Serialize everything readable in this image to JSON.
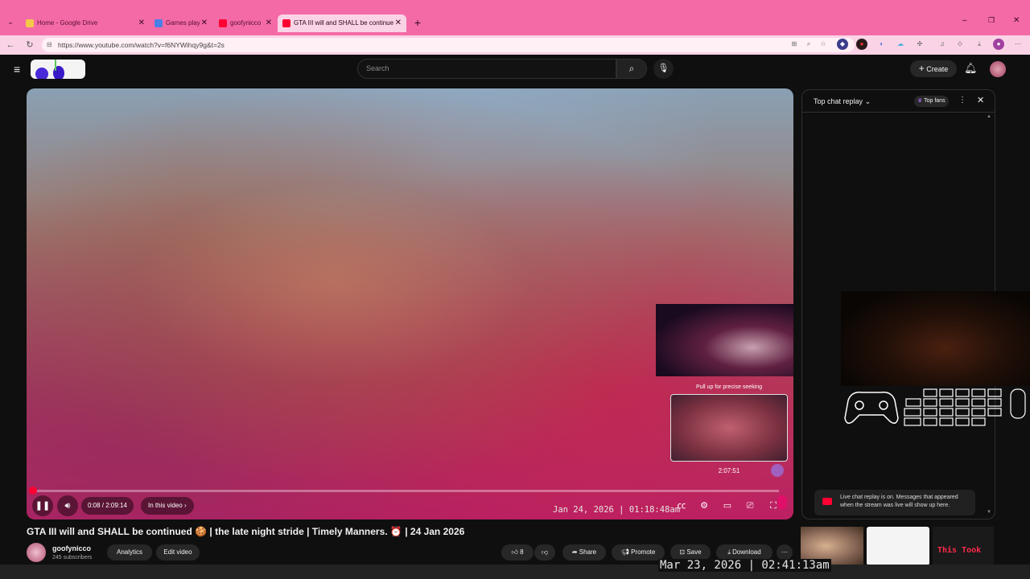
{
  "browser": {
    "tabs": [
      {
        "label": "Home - Google Drive",
        "active": false
      },
      {
        "label": "Games play",
        "active": false
      },
      {
        "label": "goofynicco",
        "active": false
      },
      {
        "label": "GTA III will and SHALL be continue",
        "active": true
      }
    ],
    "url": "https://www.youtube.com/watch?v=f6NYWihqy9g&t=2s"
  },
  "header": {
    "search_placeholder": "Search",
    "create_label": "Create"
  },
  "player": {
    "pull_up_hint": "Pull up for precise seeking",
    "preview_time": "2:07:51",
    "time_display": "0:08 / 2:09:14",
    "chapter_label": "In this video",
    "video_timestamp": "Jan 24, 2026 | 01:18:48am",
    "progress_fraction": 0.001
  },
  "chat": {
    "title": "Top chat replay",
    "top_fans_label": "Top fans",
    "notice": "Live chat replay is on. Messages that appeared when the stream was live will show up here."
  },
  "video": {
    "title": "GTA III will and SHALL be continued 🍪 | the late night stride | Timely Manners. ⏰ | 24 Jan 2026",
    "channel_name": "goofynicco",
    "subscribers": "245 subscribers",
    "analytics_label": "Analytics",
    "edit_label": "Edit video",
    "like_count": "8",
    "share_label": "Share",
    "promote_label": "Promote",
    "save_label": "Save",
    "download_label": "Download"
  },
  "overlay": {
    "thumb_text": "This Took",
    "recording_timestamp": "Mar 23, 2026 | 02:41:13am"
  },
  "colors": {
    "accent": "#ff0033",
    "browser_pink": "#f36aa6"
  }
}
